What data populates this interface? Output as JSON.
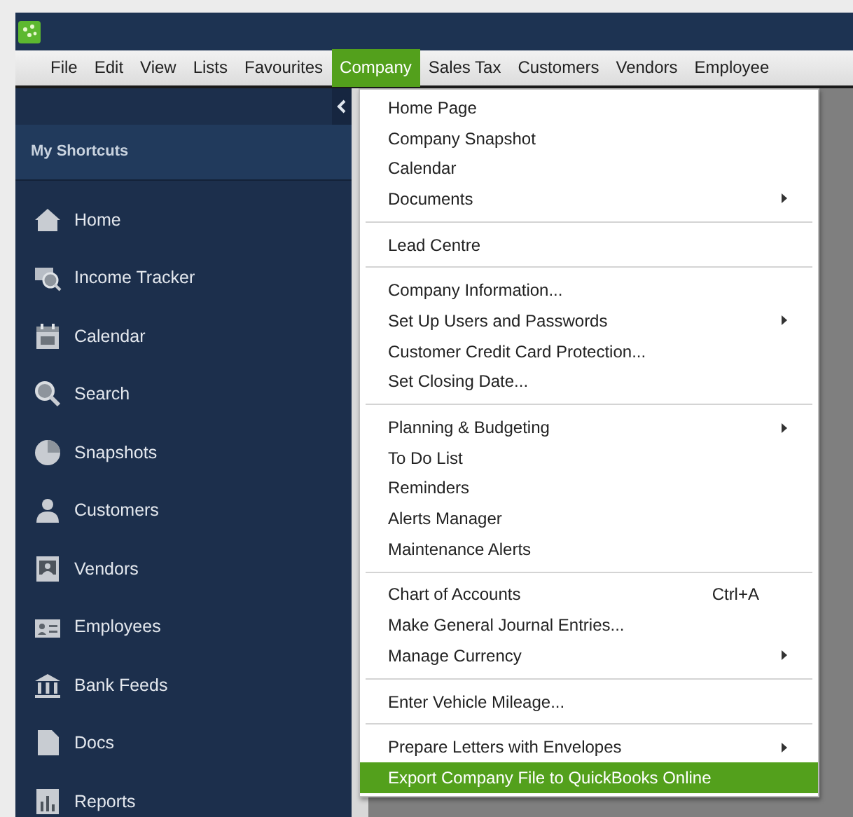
{
  "menu_bar": [
    {
      "label": "File",
      "selected": false
    },
    {
      "label": "Edit",
      "selected": false
    },
    {
      "label": "View",
      "selected": false
    },
    {
      "label": "Lists",
      "selected": false
    },
    {
      "label": "Favourites",
      "selected": false
    },
    {
      "label": "Company",
      "selected": true
    },
    {
      "label": "Sales Tax",
      "selected": false
    },
    {
      "label": "Customers",
      "selected": false
    },
    {
      "label": "Vendors",
      "selected": false
    },
    {
      "label": "Employee",
      "selected": false
    }
  ],
  "sidebar": {
    "heading": "My Shortcuts",
    "items": [
      {
        "label": "Home"
      },
      {
        "label": "Income Tracker"
      },
      {
        "label": "Calendar"
      },
      {
        "label": "Search"
      },
      {
        "label": "Snapshots"
      },
      {
        "label": "Customers"
      },
      {
        "label": "Vendors"
      },
      {
        "label": "Employees"
      },
      {
        "label": "Bank Feeds"
      },
      {
        "label": "Docs"
      },
      {
        "label": "Reports"
      }
    ]
  },
  "company_menu": {
    "groups": [
      {
        "items": [
          {
            "label": "Home Page",
            "submenu": false,
            "selected": false
          },
          {
            "label": "Company Snapshot",
            "submenu": false,
            "selected": false
          },
          {
            "label": "Calendar",
            "submenu": false,
            "selected": false
          },
          {
            "label": "Documents",
            "submenu": true,
            "selected": false
          }
        ]
      },
      {
        "items": [
          {
            "label": "Lead Centre",
            "submenu": false,
            "selected": false
          }
        ]
      },
      {
        "items": [
          {
            "label": "Company Information...",
            "submenu": false,
            "selected": false
          },
          {
            "label": "Set Up Users and Passwords",
            "submenu": true,
            "selected": false
          },
          {
            "label": "Customer Credit Card Protection...",
            "submenu": false,
            "selected": false
          },
          {
            "label": "Set Closing Date...",
            "submenu": false,
            "selected": false
          }
        ]
      },
      {
        "items": [
          {
            "label": "Planning & Budgeting",
            "submenu": true,
            "selected": false
          },
          {
            "label": "To Do List",
            "submenu": false,
            "selected": false
          },
          {
            "label": "Reminders",
            "submenu": false,
            "selected": false
          },
          {
            "label": "Alerts Manager",
            "submenu": false,
            "selected": false
          },
          {
            "label": "Maintenance Alerts",
            "submenu": false,
            "selected": false
          }
        ]
      },
      {
        "items": [
          {
            "label": "Chart of Accounts",
            "shortcut": "Ctrl+A",
            "submenu": false,
            "selected": false
          },
          {
            "label": "Make General Journal Entries...",
            "submenu": false,
            "selected": false
          },
          {
            "label": "Manage Currency",
            "submenu": true,
            "selected": false
          }
        ]
      },
      {
        "items": [
          {
            "label": "Enter Vehicle Mileage...",
            "submenu": false,
            "selected": false
          }
        ]
      },
      {
        "items": [
          {
            "label": "Prepare Letters with Envelopes",
            "submenu": true,
            "selected": false
          },
          {
            "label": "Export Company File to QuickBooks Online",
            "submenu": false,
            "selected": true
          }
        ]
      }
    ]
  }
}
